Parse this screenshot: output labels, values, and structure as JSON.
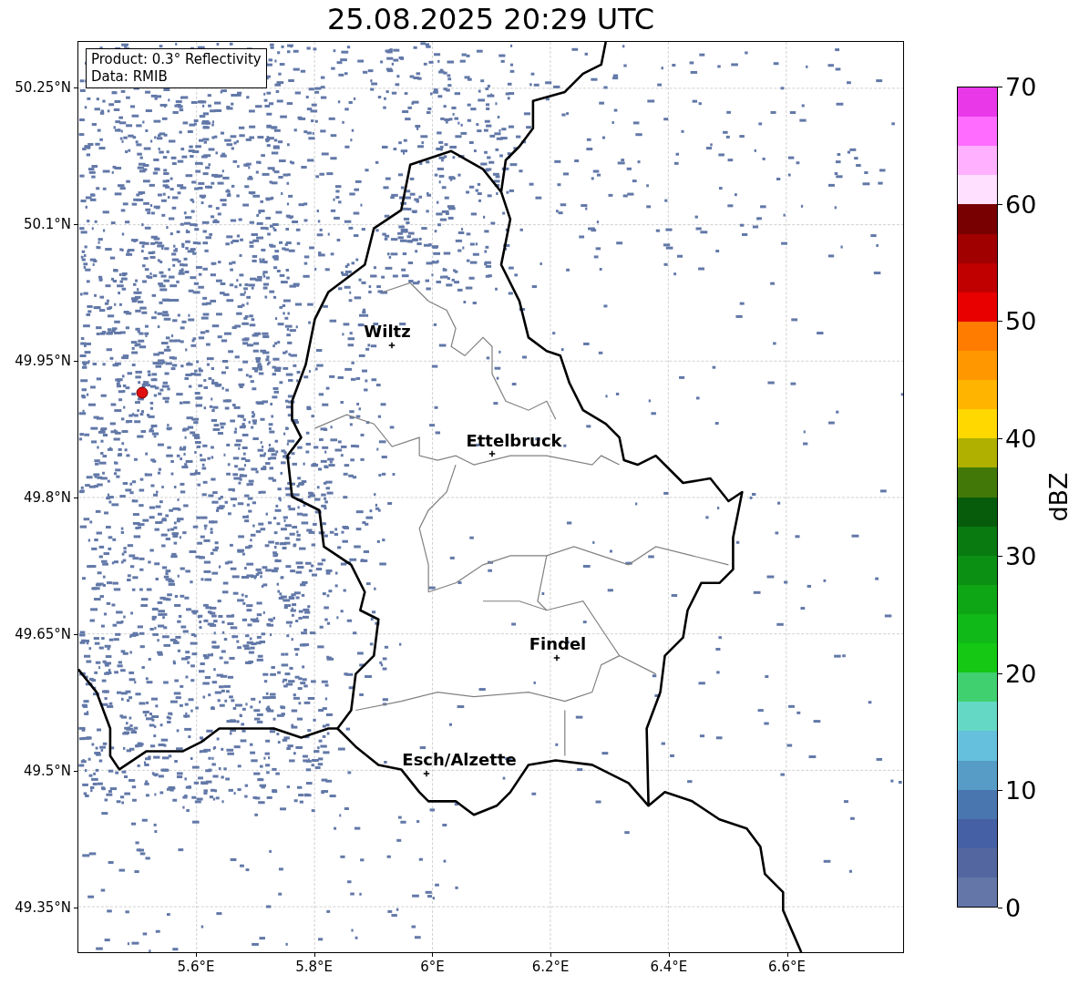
{
  "title": "25.08.2025 20:29 UTC",
  "info_box": {
    "lines": [
      "Product: 0.3° Reflectivity",
      "Data: RMIB"
    ]
  },
  "y_axis": {
    "ticks": [
      "50.25°N",
      "50.1°N",
      "49.95°N",
      "49.8°N",
      "49.65°N",
      "49.5°N",
      "49.35°N"
    ]
  },
  "x_axis": {
    "ticks": [
      "5.6°E",
      "5.8°E",
      "6°E",
      "6.2°E",
      "6.4°E",
      "6.6°E"
    ]
  },
  "cities": [
    "Wiltz",
    "Ettelbruck",
    "Findel",
    "Esch/Alzette"
  ],
  "colorbar": {
    "label": "dBZ",
    "ticks": [
      "70",
      "60",
      "50",
      "40",
      "30",
      "20",
      "10",
      "0"
    ],
    "bands": [
      {
        "color": "#e838e8"
      },
      {
        "color": "#ff6cff"
      },
      {
        "color": "#ffb0ff"
      },
      {
        "color": "#ffe0ff"
      },
      {
        "color": "#780000"
      },
      {
        "color": "#a00000"
      },
      {
        "color": "#c00000"
      },
      {
        "color": "#e80000"
      },
      {
        "color": "#ff7c00"
      },
      {
        "color": "#ff9800"
      },
      {
        "color": "#ffb400"
      },
      {
        "color": "#ffd800"
      },
      {
        "color": "#b0b000"
      },
      {
        "color": "#427808"
      },
      {
        "color": "#065c0a"
      },
      {
        "color": "#087a10"
      },
      {
        "color": "#0c9014"
      },
      {
        "color": "#0ea614"
      },
      {
        "color": "#10b818"
      },
      {
        "color": "#14c814"
      },
      {
        "color": "#40d070"
      },
      {
        "color": "#64d8c4"
      },
      {
        "color": "#64c0dc"
      },
      {
        "color": "#569cc6"
      },
      {
        "color": "#4a76b0"
      },
      {
        "color": "#4560a4"
      },
      {
        "color": "#5466a0"
      },
      {
        "color": "#6475a8"
      }
    ]
  }
}
